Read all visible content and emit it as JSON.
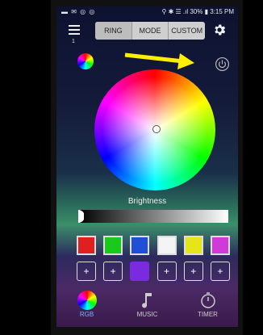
{
  "status_bar": {
    "left_icons": "▬ ✉ ◎ ◎",
    "right_text": "⚲ ✱ ☰ .ıl 30% ▮ 3:15 PM"
  },
  "header": {
    "menu_badge": "1",
    "tabs": [
      {
        "label": "RING",
        "active": true
      },
      {
        "label": "MODE",
        "active": false
      },
      {
        "label": "CUSTOM",
        "active": false
      }
    ]
  },
  "brightness": {
    "label": "Brightness",
    "level": 0.0
  },
  "swatches": [
    "#e02020",
    "#19c91c",
    "#1f4fd6",
    "#f4f4f4",
    "#e5e51a",
    "#d03ad8"
  ],
  "add_slots": [
    {
      "label": "+",
      "filled": false
    },
    {
      "label": "+",
      "filled": false
    },
    {
      "label": "",
      "filled": true,
      "color": "#7a2adf"
    },
    {
      "label": "+",
      "filled": false
    },
    {
      "label": "+",
      "filled": false
    },
    {
      "label": "+",
      "filled": false
    }
  ],
  "bottom_nav": [
    {
      "label": "RGB",
      "icon": "rgb-wheel-icon",
      "active": true
    },
    {
      "label": "MUSIC",
      "icon": "music-note-icon",
      "active": false
    },
    {
      "label": "TIMER",
      "icon": "timer-icon",
      "active": false
    }
  ],
  "colors": {
    "accent": "#6db8ff",
    "annotation_arrow": "#ffee00"
  }
}
